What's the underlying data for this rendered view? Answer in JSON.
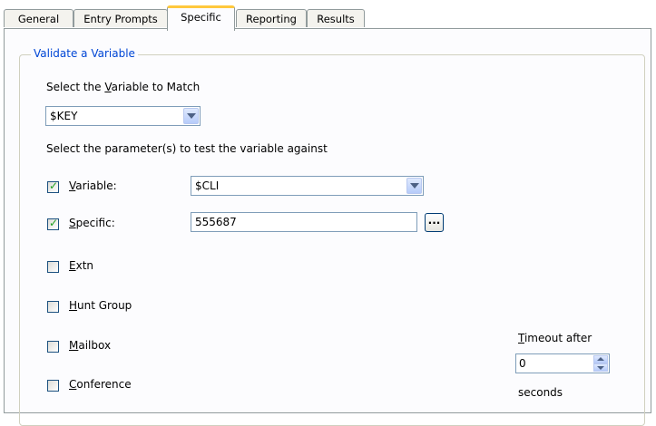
{
  "tabs": [
    {
      "label": "General"
    },
    {
      "label": "Entry Prompts"
    },
    {
      "label": "Specific"
    },
    {
      "label": "Reporting"
    },
    {
      "label": "Results"
    }
  ],
  "active_tab": "Specific",
  "group": {
    "title": "Validate a Variable",
    "select_var_label_pre": "Select the ",
    "select_var_label_u": "V",
    "select_var_label_post": "ariable to Match",
    "variable_combo_value": "$KEY",
    "param_label": "Select the parameter(s) to test the variable against"
  },
  "params": {
    "variable": {
      "checked": true,
      "label_u": "V",
      "label_rest": "ariable:",
      "value": "$CLI"
    },
    "specific": {
      "checked": true,
      "label_u": "S",
      "label_rest": "pecific:",
      "value": "555687"
    },
    "extn": {
      "checked": false,
      "label_u": "E",
      "label_rest": "xtn"
    },
    "hunt_group": {
      "checked": false,
      "label_u": "H",
      "label_rest": "unt Group"
    },
    "mailbox": {
      "checked": false,
      "label_u": "M",
      "label_rest": "ailbox"
    },
    "conference": {
      "checked": false,
      "label_u": "C",
      "label_rest": "onference"
    }
  },
  "timeout": {
    "label_u": "T",
    "label_rest": "imeout after",
    "value": "0",
    "unit": "seconds"
  },
  "ellipsis_label": "...",
  "check_mark": "✓"
}
